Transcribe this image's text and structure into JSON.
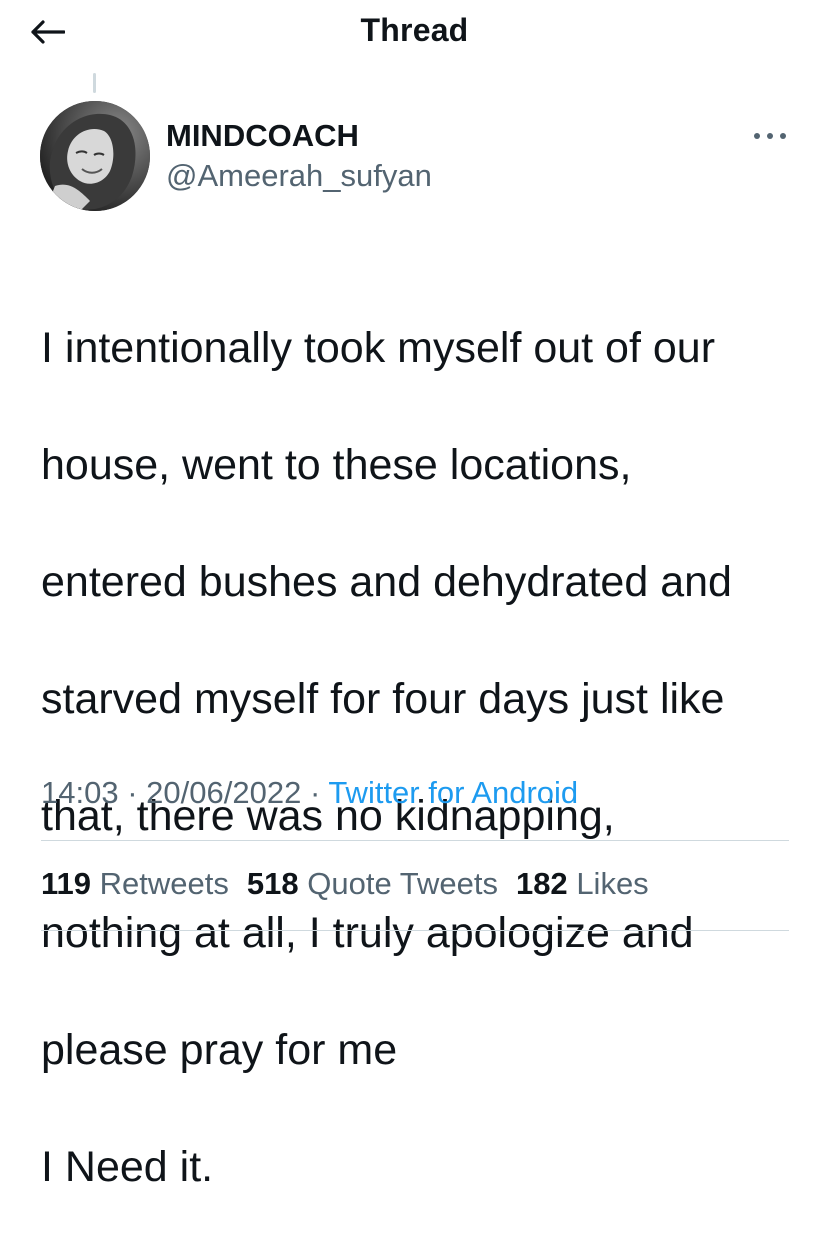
{
  "header": {
    "title": "Thread",
    "back_icon": "arrow-left-icon"
  },
  "tweet": {
    "author": {
      "name": "MINDCOACH",
      "handle": "@Ameerah_sufyan",
      "avatar_icon": "avatar-photo"
    },
    "more_icon": "more-horizontal-icon",
    "lines": [
      "I intentionally took myself out of our",
      "house, went to these locations,",
      "entered bushes and dehydrated and",
      "starved myself for four days just like",
      "that, there was no kidnapping,",
      "nothing at all, I truly apologize and",
      "please pray for me",
      "I Need it."
    ],
    "time": "14:03",
    "date": "20/06/2022",
    "separator": "·",
    "source": "Twitter for Android"
  },
  "stats": {
    "retweets": {
      "count": "119",
      "label": "Retweets"
    },
    "quotes": {
      "count": "518",
      "label": "Quote Tweets"
    },
    "likes": {
      "count": "182",
      "label": "Likes"
    }
  },
  "colors": {
    "text": "#0f1419",
    "secondary": "#536471",
    "link": "#1d9bf0",
    "divider": "#cfd9de"
  }
}
